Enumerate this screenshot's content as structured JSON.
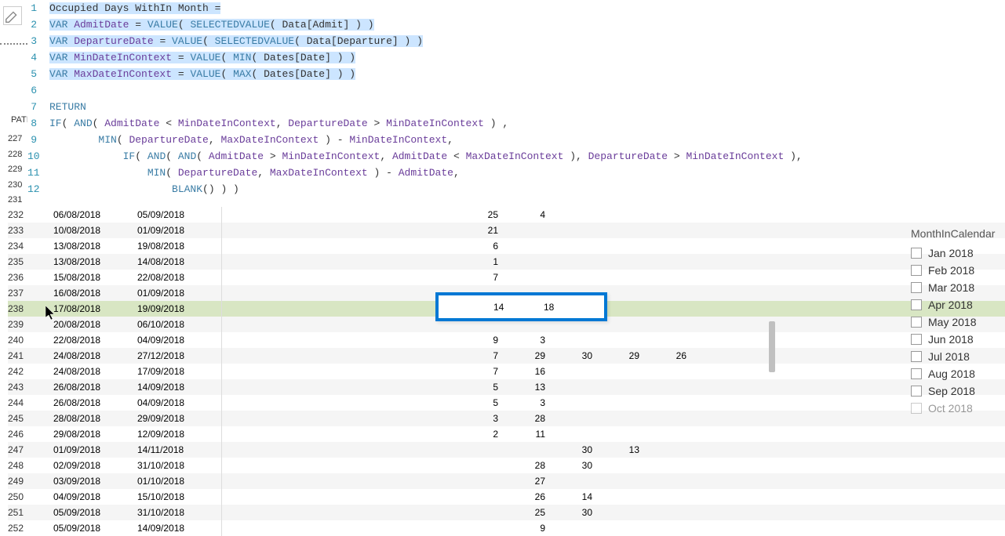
{
  "code": {
    "lines": [
      {
        "n": "1",
        "highlighted": true,
        "tokens": [
          {
            "t": "Occupied Days WithIn Month ",
            "c": "txt"
          },
          {
            "t": "=",
            "c": "txt"
          }
        ]
      },
      {
        "n": "2",
        "highlighted": true,
        "tokens": [
          {
            "t": "VAR",
            "c": "kw"
          },
          {
            "t": " AdmitDate ",
            "c": "var"
          },
          {
            "t": "= ",
            "c": "txt"
          },
          {
            "t": "VALUE",
            "c": "fn"
          },
          {
            "t": "( ",
            "c": "txt"
          },
          {
            "t": "SELECTEDVALUE",
            "c": "fn"
          },
          {
            "t": "( Data[Admit] ) )",
            "c": "txt"
          }
        ]
      },
      {
        "n": "3",
        "highlighted": true,
        "tokens": [
          {
            "t": "VAR",
            "c": "kw"
          },
          {
            "t": " DepartureDate ",
            "c": "var"
          },
          {
            "t": "= ",
            "c": "txt"
          },
          {
            "t": "VALUE",
            "c": "fn"
          },
          {
            "t": "( ",
            "c": "txt"
          },
          {
            "t": "SELECTEDVALUE",
            "c": "fn"
          },
          {
            "t": "( Data[Departure] ) )",
            "c": "txt"
          }
        ]
      },
      {
        "n": "4",
        "highlighted": true,
        "tokens": [
          {
            "t": "VAR",
            "c": "kw"
          },
          {
            "t": " MinDateInContext ",
            "c": "var"
          },
          {
            "t": "= ",
            "c": "txt"
          },
          {
            "t": "VALUE",
            "c": "fn"
          },
          {
            "t": "( ",
            "c": "txt"
          },
          {
            "t": "MIN",
            "c": "fn"
          },
          {
            "t": "( Dates[Date] ) )",
            "c": "txt"
          }
        ]
      },
      {
        "n": "5",
        "highlighted": true,
        "tokens": [
          {
            "t": "VAR",
            "c": "kw"
          },
          {
            "t": " MaxDateInContext ",
            "c": "var"
          },
          {
            "t": "= ",
            "c": "txt"
          },
          {
            "t": "VALUE",
            "c": "fn"
          },
          {
            "t": "( ",
            "c": "txt"
          },
          {
            "t": "MAX",
            "c": "fn"
          },
          {
            "t": "( Dates[Date] ) )",
            "c": "txt"
          }
        ]
      },
      {
        "n": "6",
        "highlighted": false,
        "tokens": []
      },
      {
        "n": "7",
        "highlighted": false,
        "tokens": [
          {
            "t": "RETURN",
            "c": "kw"
          }
        ]
      },
      {
        "n": "8",
        "highlighted": false,
        "tokens": [
          {
            "t": "IF",
            "c": "fn"
          },
          {
            "t": "( ",
            "c": "txt"
          },
          {
            "t": "AND",
            "c": "fn"
          },
          {
            "t": "( ",
            "c": "txt"
          },
          {
            "t": "AdmitDate",
            "c": "var"
          },
          {
            "t": " < ",
            "c": "txt"
          },
          {
            "t": "MinDateInContext",
            "c": "var"
          },
          {
            "t": ", ",
            "c": "txt"
          },
          {
            "t": "DepartureDate",
            "c": "var"
          },
          {
            "t": " > ",
            "c": "txt"
          },
          {
            "t": "MinDateInContext",
            "c": "var"
          },
          {
            "t": " ) ,",
            "c": "txt"
          }
        ]
      },
      {
        "n": "9",
        "highlighted": false,
        "tokens": [
          {
            "t": "        ",
            "c": "txt"
          },
          {
            "t": "MIN",
            "c": "fn"
          },
          {
            "t": "( ",
            "c": "txt"
          },
          {
            "t": "DepartureDate",
            "c": "var"
          },
          {
            "t": ", ",
            "c": "txt"
          },
          {
            "t": "MaxDateInContext",
            "c": "var"
          },
          {
            "t": " ) - ",
            "c": "txt"
          },
          {
            "t": "MinDateInContext",
            "c": "var"
          },
          {
            "t": ",",
            "c": "txt"
          }
        ]
      },
      {
        "n": "10",
        "highlighted": false,
        "tokens": [
          {
            "t": "            ",
            "c": "txt"
          },
          {
            "t": "IF",
            "c": "fn"
          },
          {
            "t": "( ",
            "c": "txt"
          },
          {
            "t": "AND",
            "c": "fn"
          },
          {
            "t": "( ",
            "c": "txt"
          },
          {
            "t": "AND",
            "c": "fn"
          },
          {
            "t": "( ",
            "c": "txt"
          },
          {
            "t": "AdmitDate",
            "c": "var"
          },
          {
            "t": " > ",
            "c": "txt"
          },
          {
            "t": "MinDateInContext",
            "c": "var"
          },
          {
            "t": ", ",
            "c": "txt"
          },
          {
            "t": "AdmitDate",
            "c": "var"
          },
          {
            "t": " < ",
            "c": "txt"
          },
          {
            "t": "MaxDateInContext",
            "c": "var"
          },
          {
            "t": " ), ",
            "c": "txt"
          },
          {
            "t": "DepartureDate",
            "c": "var"
          },
          {
            "t": " > ",
            "c": "txt"
          },
          {
            "t": "MinDateInContext",
            "c": "var"
          },
          {
            "t": " ),",
            "c": "txt"
          }
        ]
      },
      {
        "n": "11",
        "highlighted": false,
        "tokens": [
          {
            "t": "                ",
            "c": "txt"
          },
          {
            "t": "MIN",
            "c": "fn"
          },
          {
            "t": "( ",
            "c": "txt"
          },
          {
            "t": "DepartureDate",
            "c": "var"
          },
          {
            "t": ", ",
            "c": "txt"
          },
          {
            "t": "MaxDateInContext",
            "c": "var"
          },
          {
            "t": " ) - ",
            "c": "txt"
          },
          {
            "t": "AdmitDate",
            "c": "var"
          },
          {
            "t": ",",
            "c": "txt"
          }
        ]
      },
      {
        "n": "12",
        "highlighted": false,
        "tokens": [
          {
            "t": "                    ",
            "c": "txt"
          },
          {
            "t": "BLANK",
            "c": "fn"
          },
          {
            "t": "() ) )",
            "c": "txt"
          }
        ]
      }
    ]
  },
  "left_label": "PATI",
  "left_nums": [
    "227",
    "228",
    "229",
    "230",
    "231"
  ],
  "rows": [
    {
      "rn": "232",
      "d1": "06/08/2018",
      "d2": "05/09/2018",
      "n1": "25",
      "n2": "4",
      "n3": "",
      "n4": "",
      "n5": "",
      "sel": false
    },
    {
      "rn": "233",
      "d1": "10/08/2018",
      "d2": "01/09/2018",
      "n1": "21",
      "n2": "",
      "n3": "",
      "n4": "",
      "n5": "",
      "sel": false
    },
    {
      "rn": "234",
      "d1": "13/08/2018",
      "d2": "19/08/2018",
      "n1": "6",
      "n2": "",
      "n3": "",
      "n4": "",
      "n5": "",
      "sel": false
    },
    {
      "rn": "235",
      "d1": "13/08/2018",
      "d2": "14/08/2018",
      "n1": "1",
      "n2": "",
      "n3": "",
      "n4": "",
      "n5": "",
      "sel": false
    },
    {
      "rn": "236",
      "d1": "15/08/2018",
      "d2": "22/08/2018",
      "n1": "7",
      "n2": "",
      "n3": "",
      "n4": "",
      "n5": "",
      "sel": false
    },
    {
      "rn": "237",
      "d1": "16/08/2018",
      "d2": "01/09/2018",
      "n1": "",
      "n2": "",
      "n3": "",
      "n4": "",
      "n5": "",
      "sel": false
    },
    {
      "rn": "238",
      "d1": "17/08/2018",
      "d2": "19/09/2018",
      "n1": "14",
      "n2": "18",
      "n3": "",
      "n4": "",
      "n5": "",
      "sel": true
    },
    {
      "rn": "239",
      "d1": "20/08/2018",
      "d2": "06/10/2018",
      "n1": "",
      "n2": "",
      "n3": "",
      "n4": "",
      "n5": "",
      "sel": false
    },
    {
      "rn": "240",
      "d1": "22/08/2018",
      "d2": "04/09/2018",
      "n1": "9",
      "n2": "3",
      "n3": "",
      "n4": "",
      "n5": "",
      "sel": false
    },
    {
      "rn": "241",
      "d1": "24/08/2018",
      "d2": "27/12/2018",
      "n1": "7",
      "n2": "29",
      "n3": "30",
      "n4": "29",
      "n5": "26",
      "sel": false
    },
    {
      "rn": "242",
      "d1": "24/08/2018",
      "d2": "17/09/2018",
      "n1": "7",
      "n2": "16",
      "n3": "",
      "n4": "",
      "n5": "",
      "sel": false
    },
    {
      "rn": "243",
      "d1": "26/08/2018",
      "d2": "14/09/2018",
      "n1": "5",
      "n2": "13",
      "n3": "",
      "n4": "",
      "n5": "",
      "sel": false
    },
    {
      "rn": "244",
      "d1": "26/08/2018",
      "d2": "04/09/2018",
      "n1": "5",
      "n2": "3",
      "n3": "",
      "n4": "",
      "n5": "",
      "sel": false
    },
    {
      "rn": "245",
      "d1": "28/08/2018",
      "d2": "29/09/2018",
      "n1": "3",
      "n2": "28",
      "n3": "",
      "n4": "",
      "n5": "",
      "sel": false
    },
    {
      "rn": "246",
      "d1": "29/08/2018",
      "d2": "12/09/2018",
      "n1": "2",
      "n2": "11",
      "n3": "",
      "n4": "",
      "n5": "",
      "sel": false
    },
    {
      "rn": "247",
      "d1": "01/09/2018",
      "d2": "14/11/2018",
      "n1": "",
      "n2": "",
      "n3": "30",
      "n4": "13",
      "n5": "",
      "sel": false
    },
    {
      "rn": "248",
      "d1": "02/09/2018",
      "d2": "31/10/2018",
      "n1": "",
      "n2": "28",
      "n3": "30",
      "n4": "",
      "n5": "",
      "sel": false
    },
    {
      "rn": "249",
      "d1": "03/09/2018",
      "d2": "01/10/2018",
      "n1": "",
      "n2": "27",
      "n3": "",
      "n4": "",
      "n5": "",
      "sel": false
    },
    {
      "rn": "250",
      "d1": "04/09/2018",
      "d2": "15/10/2018",
      "n1": "",
      "n2": "26",
      "n3": "14",
      "n4": "",
      "n5": "",
      "sel": false
    },
    {
      "rn": "251",
      "d1": "05/09/2018",
      "d2": "31/10/2018",
      "n1": "",
      "n2": "25",
      "n3": "30",
      "n4": "",
      "n5": "",
      "sel": false
    },
    {
      "rn": "252",
      "d1": "05/09/2018",
      "d2": "14/09/2018",
      "n1": "",
      "n2": "9",
      "n3": "",
      "n4": "",
      "n5": "",
      "sel": false
    }
  ],
  "highlight_box": {
    "v1": "14",
    "v2": "18"
  },
  "slicer": {
    "title": "MonthInCalendar",
    "items": [
      "Jan 2018",
      "Feb 2018",
      "Mar 2018",
      "Apr 2018",
      "May 2018",
      "Jun 2018",
      "Jul 2018",
      "Aug 2018",
      "Sep 2018",
      "Oct 2018"
    ]
  }
}
